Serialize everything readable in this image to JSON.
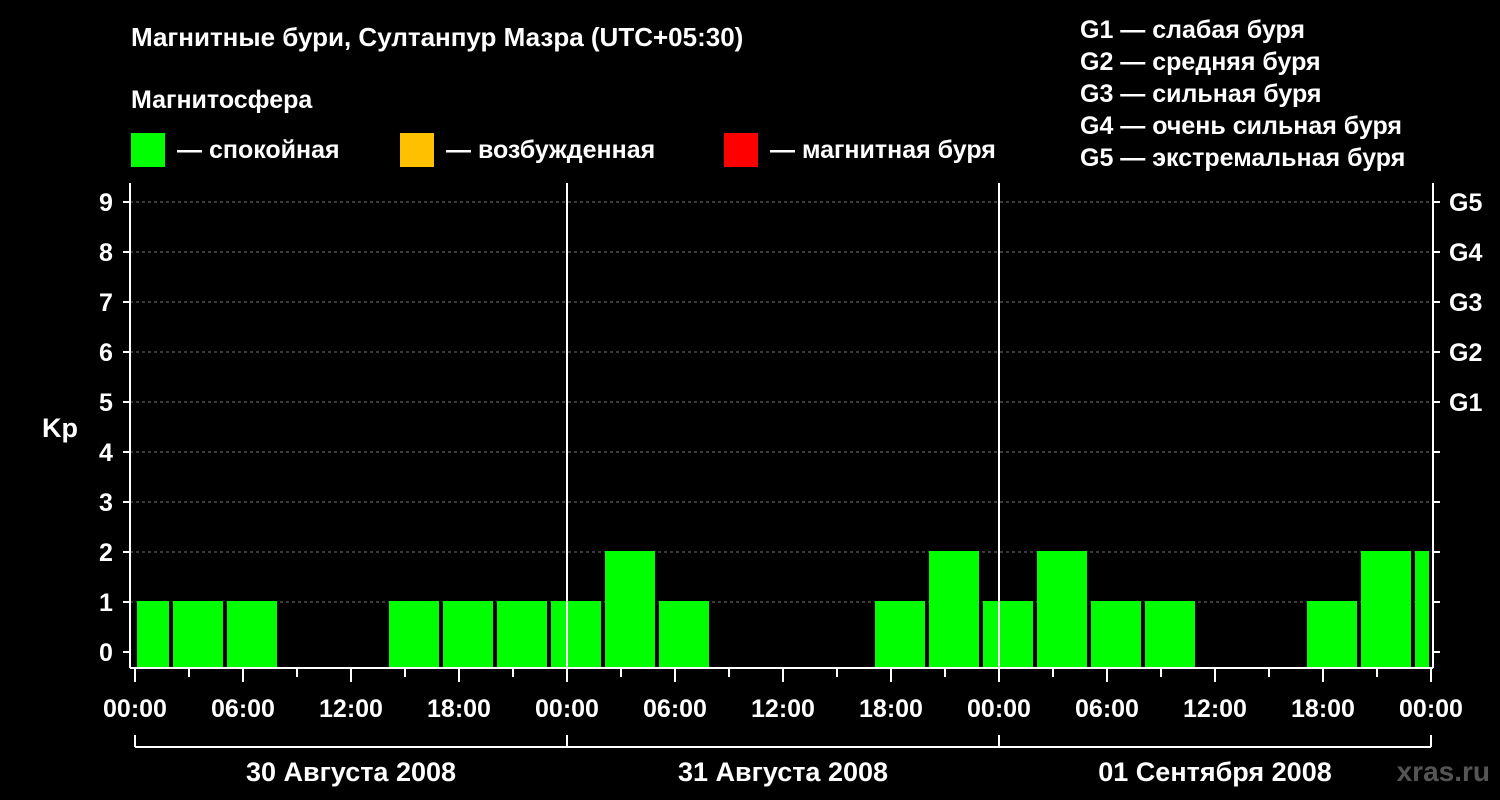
{
  "title": "Магнитные бури, Султанпур Мазра (UTC+05:30)",
  "subtitle": "Магнитосфера",
  "legend": [
    {
      "label": "— спокойная",
      "color": "#00ff00"
    },
    {
      "label": "— возбужденная",
      "color": "#ffc000"
    },
    {
      "label": "— магнитная буря",
      "color": "#ff0000"
    }
  ],
  "storm_scale": [
    "G1 — слабая буря",
    "G2 — средняя буря",
    "G3 — сильная буря",
    "G4 — очень сильная буря",
    "G5 — экстремальная буря"
  ],
  "watermark": "xras.ru",
  "chart_data": {
    "type": "bar",
    "ylabel": "Kp",
    "ylim": [
      0,
      9
    ],
    "yticks": [
      0,
      1,
      2,
      3,
      4,
      5,
      6,
      7,
      8,
      9
    ],
    "y_right_labels": [
      {
        "value": 5,
        "label": "G1"
      },
      {
        "value": 6,
        "label": "G2"
      },
      {
        "value": 7,
        "label": "G3"
      },
      {
        "value": 8,
        "label": "G4"
      },
      {
        "value": 9,
        "label": "G5"
      }
    ],
    "grid": true,
    "x_tick_labels": [
      "00:00",
      "06:00",
      "12:00",
      "18:00",
      "00:00",
      "06:00",
      "12:00",
      "18:00",
      "00:00",
      "06:00",
      "12:00",
      "18:00",
      "00:00"
    ],
    "x_hours_total": 72,
    "day_dividers_hours": [
      24,
      48
    ],
    "days": [
      "30 Августа 2008",
      "31 Августа 2008",
      "01 Сентября 2008"
    ],
    "bars": [
      {
        "start_hour": 0,
        "end_hour": 2,
        "value": 1,
        "color": "#00ff00"
      },
      {
        "start_hour": 2,
        "end_hour": 5,
        "value": 1,
        "color": "#00ff00"
      },
      {
        "start_hour": 5,
        "end_hour": 8,
        "value": 1,
        "color": "#00ff00"
      },
      {
        "start_hour": 8,
        "end_hour": 11,
        "value": 0,
        "color": "#00ff00"
      },
      {
        "start_hour": 11,
        "end_hour": 14,
        "value": 0,
        "color": "#00ff00"
      },
      {
        "start_hour": 14,
        "end_hour": 17,
        "value": 1,
        "color": "#00ff00"
      },
      {
        "start_hour": 17,
        "end_hour": 20,
        "value": 1,
        "color": "#00ff00"
      },
      {
        "start_hour": 20,
        "end_hour": 23,
        "value": 1,
        "color": "#00ff00"
      },
      {
        "start_hour": 23,
        "end_hour": 26,
        "value": 1,
        "color": "#00ff00"
      },
      {
        "start_hour": 26,
        "end_hour": 29,
        "value": 2,
        "color": "#00ff00"
      },
      {
        "start_hour": 29,
        "end_hour": 32,
        "value": 1,
        "color": "#00ff00"
      },
      {
        "start_hour": 32,
        "end_hour": 35,
        "value": 0,
        "color": "#00ff00"
      },
      {
        "start_hour": 35,
        "end_hour": 38,
        "value": 0,
        "color": "#00ff00"
      },
      {
        "start_hour": 38,
        "end_hour": 41,
        "value": 0,
        "color": "#00ff00"
      },
      {
        "start_hour": 41,
        "end_hour": 44,
        "value": 1,
        "color": "#00ff00"
      },
      {
        "start_hour": 44,
        "end_hour": 47,
        "value": 2,
        "color": "#00ff00"
      },
      {
        "start_hour": 47,
        "end_hour": 50,
        "value": 1,
        "color": "#00ff00"
      },
      {
        "start_hour": 50,
        "end_hour": 53,
        "value": 2,
        "color": "#00ff00"
      },
      {
        "start_hour": 53,
        "end_hour": 56,
        "value": 1,
        "color": "#00ff00"
      },
      {
        "start_hour": 56,
        "end_hour": 59,
        "value": 1,
        "color": "#00ff00"
      },
      {
        "start_hour": 59,
        "end_hour": 62,
        "value": 0,
        "color": "#00ff00"
      },
      {
        "start_hour": 62,
        "end_hour": 65,
        "value": 0,
        "color": "#00ff00"
      },
      {
        "start_hour": 65,
        "end_hour": 68,
        "value": 1,
        "color": "#00ff00"
      },
      {
        "start_hour": 68,
        "end_hour": 71,
        "value": 2,
        "color": "#00ff00"
      },
      {
        "start_hour": 71,
        "end_hour": 72,
        "value": 2,
        "color": "#00ff00"
      }
    ]
  }
}
